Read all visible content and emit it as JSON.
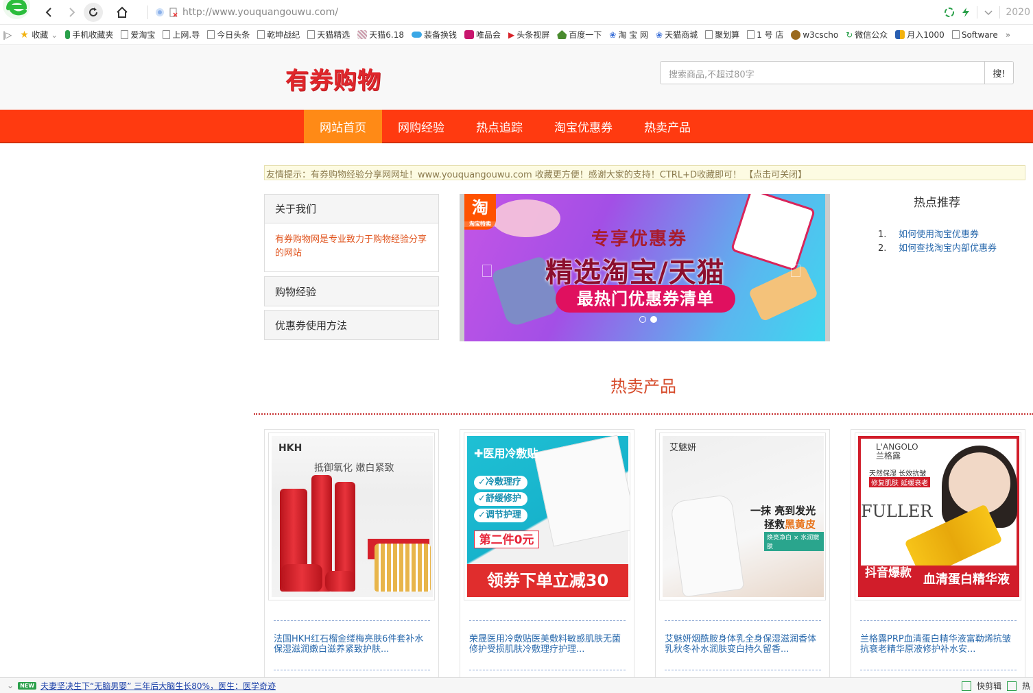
{
  "browser": {
    "url": "http://www.youquangouwu.com/",
    "date_partial": "2020",
    "bookmarks": [
      {
        "label": "收藏",
        "icon": "star-icon"
      },
      {
        "label": "手机收藏夹",
        "icon": "phone-icon"
      },
      {
        "label": "爱淘宝",
        "icon": "page-icon"
      },
      {
        "label": "上网.导",
        "icon": "page-icon"
      },
      {
        "label": "今日头条",
        "icon": "page-icon"
      },
      {
        "label": "乾坤战纪",
        "icon": "page-icon"
      },
      {
        "label": "天猫精选",
        "icon": "page-icon"
      },
      {
        "label": "天猫6.18",
        "icon": "tmall-icon"
      },
      {
        "label": "装备换钱",
        "icon": "cloud-icon"
      },
      {
        "label": "唯品会",
        "icon": "vip-icon"
      },
      {
        "label": "头条视屏",
        "icon": "play-icon"
      },
      {
        "label": "百度一下",
        "icon": "house-icon"
      },
      {
        "label": "淘 宝 网",
        "icon": "paw-icon"
      },
      {
        "label": "天猫商城",
        "icon": "paw-icon"
      },
      {
        "label": "聚划算",
        "icon": "page-icon"
      },
      {
        "label": "1 号 店",
        "icon": "page-icon"
      },
      {
        "label": "w3cscho",
        "icon": "w3c-icon"
      },
      {
        "label": "微信公众",
        "icon": "wechat-icon"
      },
      {
        "label": "月入1000",
        "icon": "chart-icon"
      },
      {
        "label": "Software",
        "icon": "page-icon"
      }
    ],
    "more": "»"
  },
  "site": {
    "logo": "有券购物",
    "search_placeholder": "搜索商品,不超过80字",
    "search_button": "搜!",
    "nav": [
      "网站首页",
      "网购经验",
      "热点追踪",
      "淘宝优惠券",
      "热卖产品"
    ],
    "notice": "友情提示：有券购物经验分享网网址！www.youquangouwu.com 收藏更方便！感谢大家的支持！CTRL+D收藏即可！ 【点击可关闭】",
    "sidebar": {
      "about_title": "关于我们",
      "about_text": "有券购物网是专业致力于购物经验分享的网站",
      "exp_title": "购物经验",
      "coupon_title": "优惠券使用方法"
    },
    "banner": {
      "tag": "淘",
      "tag_small": "淘宝特卖",
      "sub": "专享优惠券",
      "title": "精选淘宝/天猫",
      "strip": "最热门优惠券清单"
    },
    "hot": {
      "title": "热点推荐",
      "items": [
        {
          "num": "1.",
          "label": "如何使用淘宝优惠券"
        },
        {
          "num": "2.",
          "label": "如何查找淘宝内部优惠券"
        }
      ]
    },
    "section_title": "热卖产品",
    "products": [
      {
        "title": "法国HKH红石榴金缕梅亮肤6件套补水保湿滋润嫩白滋养紧致护肤...",
        "img": {
          "brand": "HKH",
          "slogan": "抵御氧化 嫩白紧致"
        }
      },
      {
        "title": "荣晟医用冷敷贴医美敷料敏感肌肤无菌修护受损肌肤冷敷理疗护理...",
        "img": {
          "tag": "✚医用冷敷贴",
          "pills": [
            "✓冷敷理疗",
            "✓舒缓修护",
            "✓调节护理"
          ],
          "price": "第二件0元",
          "footer": "领券下单立减30"
        }
      },
      {
        "title": "艾魅妍烟酰胺身体乳全身保湿滋润香体乳秋冬补水润肤变白持久留香...",
        "img": {
          "brand": "艾魅妍",
          "copy1": "一抹 亮到发光",
          "copy2a": "拯救",
          "copy2b": "黑黄皮",
          "copy3": "焕亮净白 × 水润嫩肤"
        }
      },
      {
        "title": "兰格露PRP血清蛋白精华液富勒烯抗皱抗衰老精华原液修护补水安...",
        "img": {
          "brand": "L'ANGOLO",
          "brand_cn": "兰格露",
          "claim": "天然保湿 长效抗皱",
          "claim2": "修复肌肤 延缓衰老",
          "word": "FULLER",
          "hot": "抖音爆款",
          "footer": "血清蛋白精华液"
        }
      }
    ]
  },
  "status": {
    "badge": "NEW",
    "news": "夫妻坚决生下“无脑男婴” 三年后大脑生长80%，医生：医学奇迹",
    "right": "快剪辑",
    "edge": "热"
  },
  "colors": {
    "nav_bg": "#ff3a10",
    "nav_active": "#ff8a16",
    "logo": "#e0262b",
    "link": "#2a6aad"
  }
}
